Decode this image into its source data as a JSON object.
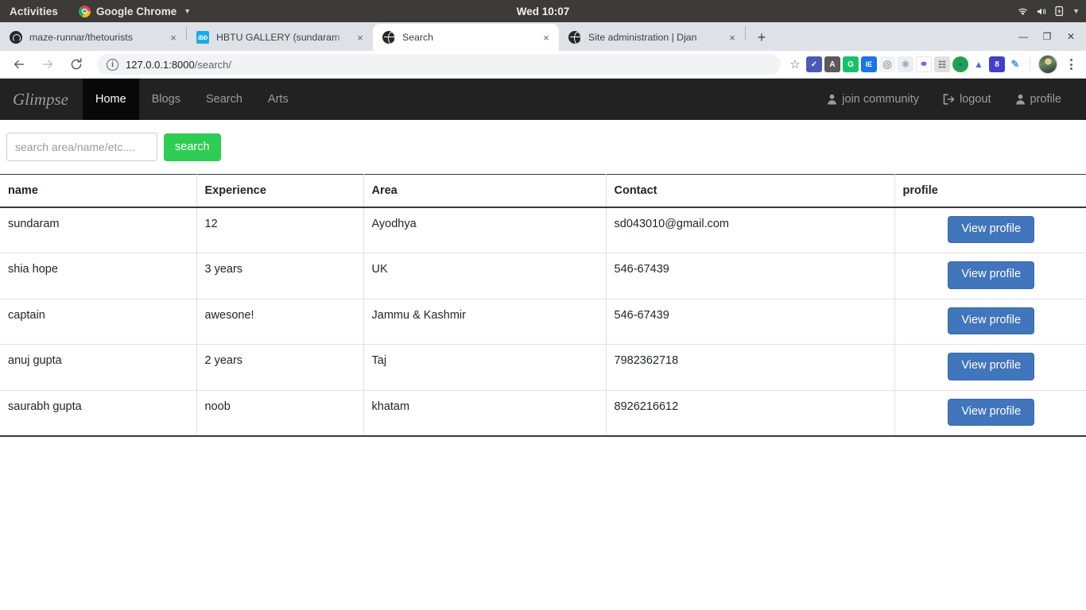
{
  "os_bar": {
    "activities": "Activities",
    "app_name": "Google Chrome",
    "clock": "Wed 10:07",
    "tray_icons": [
      "wifi-icon",
      "volume-icon",
      "battery-icon",
      "chevron-down-icon"
    ]
  },
  "browser": {
    "tabs": [
      {
        "title": "maze-runnar/thetourists",
        "favicon": "github-icon",
        "active": false
      },
      {
        "title": "HBTU GALLERY (sundaram",
        "favicon": "ibb-icon",
        "active": false
      },
      {
        "title": "Search",
        "favicon": "globe-icon",
        "active": true
      },
      {
        "title": "Site administration | Djan",
        "favicon": "globe-icon",
        "active": false
      }
    ],
    "new_tab_label": "+",
    "close_label": "×",
    "window_controls": {
      "minimize": "—",
      "maximize": "❐",
      "close": "✕"
    },
    "omnibox": {
      "host": "127.0.0.1:8000",
      "path": "/search/",
      "info_icon": "i"
    },
    "back_icon": "arrow-left-icon",
    "forward_icon": "arrow-right-icon",
    "reload_icon": "reload-icon",
    "star_icon": "☆",
    "extensions": [
      {
        "name": "shield-extension-icon",
        "glyph": "✓",
        "bg": "#4a5ab8",
        "fg": "#ffffff"
      },
      {
        "name": "angular-extension-icon",
        "glyph": "A",
        "bg": "#5a5a5a",
        "fg": "#ffffff"
      },
      {
        "name": "grammarly-extension-icon",
        "glyph": "G",
        "bg": "#15c26b",
        "fg": "#ffffff"
      },
      {
        "name": "pages-extension-icon",
        "glyph": "IE",
        "bg": "#1a73e8",
        "fg": "#ffffff"
      },
      {
        "name": "target-extension-icon",
        "glyph": "◎",
        "bg": "#f1f3f4",
        "fg": "#9aa0a6"
      },
      {
        "name": "react-devtools-extension-icon",
        "glyph": "⚛",
        "bg": "#eceff1",
        "fg": "#9aa0a6"
      },
      {
        "name": "molecule-extension-icon",
        "glyph": "⚭",
        "bg": "#ffffff",
        "fg": "#7e57c2"
      },
      {
        "name": "document-extension-icon",
        "glyph": "☷",
        "bg": "#e0e0e0",
        "fg": "#616161"
      },
      {
        "name": "globe-extension-icon",
        "glyph": "●",
        "bg": "#1fa24a",
        "fg": "#1565c0"
      },
      {
        "name": "upload-extension-icon",
        "glyph": "▲",
        "bg": "#5c6bc0",
        "fg": "#ffffff"
      },
      {
        "name": "search-engine-extension-icon",
        "glyph": "8",
        "bg": "#4040c8",
        "fg": "#ffffff"
      },
      {
        "name": "feather-extension-icon",
        "glyph": "✎",
        "bg": "#ffffff",
        "fg": "#4aa3df"
      }
    ],
    "avatar_name": "profile-avatar",
    "menu_icon": "kebab-menu-icon"
  },
  "site": {
    "brand": "Glimpse",
    "nav_items": [
      {
        "label": "Home",
        "active": true
      },
      {
        "label": "Blogs",
        "active": false
      },
      {
        "label": "Search",
        "active": false
      },
      {
        "label": "Arts",
        "active": false
      }
    ],
    "nav_right": [
      {
        "label": "join community",
        "icon": "user-icon"
      },
      {
        "label": "logout",
        "icon": "logout-icon"
      },
      {
        "label": "profile",
        "icon": "user-icon"
      }
    ],
    "search": {
      "placeholder": "search area/name/etc....",
      "value": "",
      "button_label": "search",
      "button_color": "#2ecc52"
    },
    "table": {
      "columns": [
        "name",
        "Experience",
        "Area",
        "Contact",
        "profile"
      ],
      "action_label": "View profile",
      "action_color": "#4175bc",
      "rows": [
        {
          "name": "sundaram",
          "experience": "12",
          "area": "Ayodhya",
          "contact": "sd043010@gmail.com"
        },
        {
          "name": "shia hope",
          "experience": "3 years",
          "area": "UK",
          "contact": "546-67439"
        },
        {
          "name": "captain",
          "experience": "awesone!",
          "area": "Jammu & Kashmir",
          "contact": "546-67439"
        },
        {
          "name": "anuj gupta",
          "experience": "2 years",
          "area": "Taj",
          "contact": "7982362718"
        },
        {
          "name": "saurabh gupta",
          "experience": "noob",
          "area": "khatam",
          "contact": "8926216612"
        }
      ]
    }
  }
}
